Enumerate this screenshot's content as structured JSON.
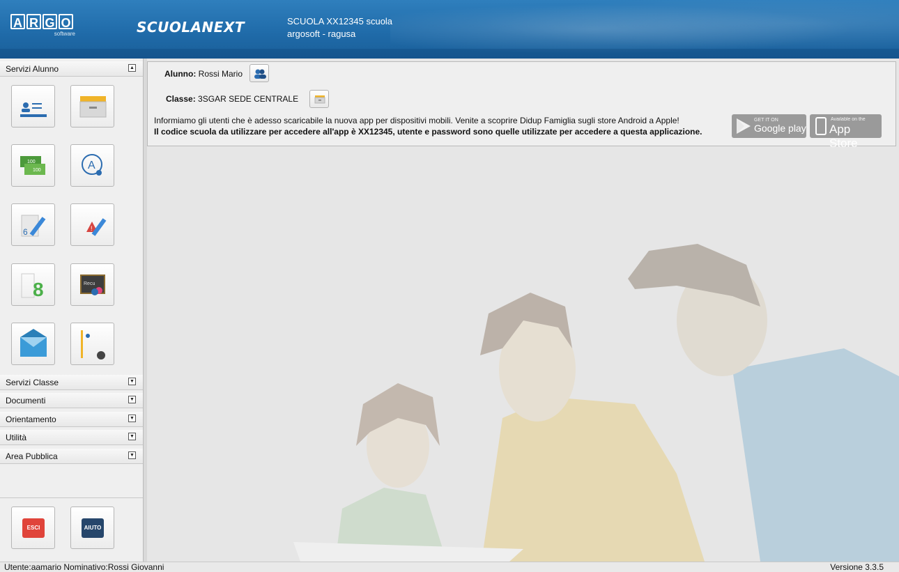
{
  "header": {
    "argo_letters": [
      "A",
      "R",
      "G",
      "O"
    ],
    "argo_sub": "software",
    "brand": "SCUOLANEXT",
    "school_name": "SCUOLA XX12345 scuola",
    "school_place": "argosoft - ragusa"
  },
  "sidebar": {
    "sections": [
      {
        "label": "Servizi Alunno",
        "state": "expanded"
      },
      {
        "label": "Servizi Classe",
        "state": "collapsed"
      },
      {
        "label": "Documenti",
        "state": "collapsed"
      },
      {
        "label": "Orientamento",
        "state": "collapsed"
      },
      {
        "label": "Utilità",
        "state": "collapsed"
      },
      {
        "label": "Area Pubblica",
        "state": "collapsed"
      }
    ],
    "tiles": [
      "student-registry-icon",
      "class-drawer-icon",
      "taxes-money-icon",
      "absences-icon",
      "grades-pencil-icon",
      "notes-warning-icon",
      "scrutiny-grades-icon",
      "recovery-blackboard-icon",
      "messages-envelope-icon",
      "profile-world-icon"
    ],
    "exit_label": "ESCI",
    "help_label": "AIUTO"
  },
  "info": {
    "alunno_label": "Alunno:",
    "alunno_value": "Rossi Mario",
    "classe_label": "Classe:",
    "classe_value": "3SGAR SEDE CENTRALE",
    "notice_line1": "Informiamo gli utenti che è adesso scaricabile la nuova app per dispositivi mobili. Venite a scoprire Didup Famiglia sugli store Android a Apple!",
    "notice_line2": "Il codice scuola da utilizzare per accedere all'app è XX12345, utente e password sono quelle utilizzate per accedere a questa applicazione.",
    "google_play_small": "GET IT ON",
    "google_play_big": "Google play",
    "app_store_small": "Available on the",
    "app_store_big": "App Store"
  },
  "footer": {
    "user_info": "Utente:aamario Nominativo:Rossi Giovanni",
    "version": "Versione 3.3.5"
  },
  "colors": {
    "header_blue": "#1f6aa8",
    "exit_red": "#e0443a",
    "help_navy": "#26466b"
  }
}
